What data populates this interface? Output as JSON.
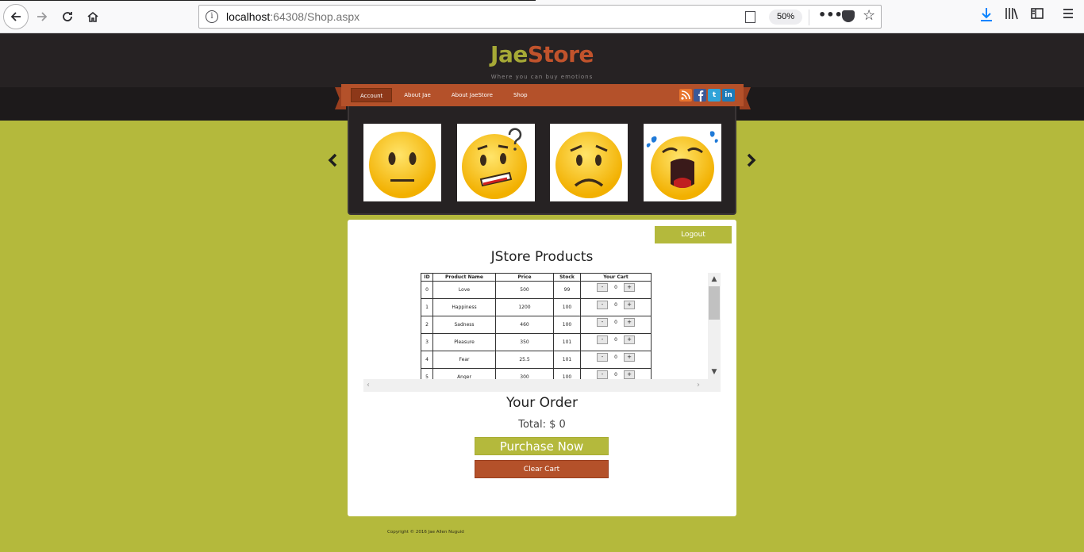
{
  "browser": {
    "url_host": "localhost",
    "url_rest": ":64308/Shop.aspx",
    "zoom": "50%",
    "more_label": "•••"
  },
  "site": {
    "logo_part1": "Jae",
    "logo_part2": "Store",
    "tagline": "Where you can buy emotions",
    "nav": [
      {
        "label": "Account",
        "active": true
      },
      {
        "label": "About Jae"
      },
      {
        "label": "About JaeStore"
      },
      {
        "label": "Shop"
      }
    ],
    "social": [
      "rss-icon",
      "facebook-icon",
      "twitter-icon",
      "linkedin-icon"
    ],
    "social_glyphs": {
      "twitter": "t",
      "linkedin": "in"
    }
  },
  "slider": {
    "prev_label": "‹",
    "next_label": "›",
    "emojis": [
      "neutral-face",
      "confused-face",
      "worried-face",
      "shocked-face"
    ]
  },
  "shop": {
    "logout_label": "Logout",
    "products_title": "JStore Products",
    "columns": [
      "ID",
      "Product Name",
      "Price",
      "Stock",
      "Your Cart"
    ],
    "rows": [
      {
        "id": "0",
        "name": "Love",
        "price": "500",
        "stock": "99",
        "qty": "0"
      },
      {
        "id": "1",
        "name": "Happiness",
        "price": "1200",
        "stock": "100",
        "qty": "0"
      },
      {
        "id": "2",
        "name": "Sadness",
        "price": "460",
        "stock": "100",
        "qty": "0"
      },
      {
        "id": "3",
        "name": "Pleasure",
        "price": "350",
        "stock": "101",
        "qty": "0"
      },
      {
        "id": "4",
        "name": "Fear",
        "price": "25.5",
        "stock": "101",
        "qty": "0"
      },
      {
        "id": "5",
        "name": "Anger",
        "price": "300",
        "stock": "100",
        "qty": "0"
      }
    ],
    "minus_label": "-",
    "plus_label": "+",
    "order_title": "Your Order",
    "total_label": "Total: $ 0",
    "purchase_label": "Purchase Now",
    "clear_label": "Clear Cart"
  },
  "footer": "Copyright © 2016 Jae Allen Nuguid",
  "colors": {
    "olive": "#b4b93c",
    "rust": "#b4512a",
    "dark": "#262223"
  }
}
